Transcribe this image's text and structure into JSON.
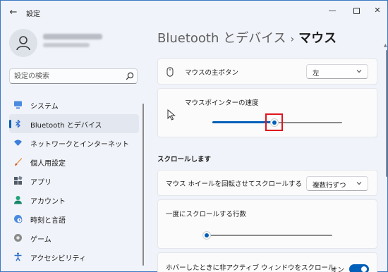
{
  "window": {
    "title": "設定",
    "back_glyph": "←",
    "min_glyph": "—",
    "close_glyph": "✕"
  },
  "sidebar": {
    "search_placeholder": "設定の検索",
    "items": [
      {
        "label": "システム",
        "icon": "monitor-icon",
        "color": "#2f6fce"
      },
      {
        "label": "Bluetooth とデバイス",
        "icon": "bluetooth-icon",
        "color": "#2f6fce",
        "active": true
      },
      {
        "label": "ネットワークとインターネット",
        "icon": "wifi-icon",
        "color": "#3b7fdc"
      },
      {
        "label": "個人用設定",
        "icon": "brush-icon",
        "color": "#e07a3c"
      },
      {
        "label": "アプリ",
        "icon": "apps-icon",
        "color": "#4a5568"
      },
      {
        "label": "アカウント",
        "icon": "account-icon",
        "color": "#1fa27a"
      },
      {
        "label": "時刻と言語",
        "icon": "globe-clock-icon",
        "color": "#2f6fce"
      },
      {
        "label": "ゲーム",
        "icon": "gamepad-icon",
        "color": "#6b6b6b"
      },
      {
        "label": "アクセシビリティ",
        "icon": "accessibility-icon",
        "color": "#2f6fce"
      }
    ]
  },
  "header": {
    "parent": "Bluetooth とデバイス",
    "separator": "›",
    "current": "マウス"
  },
  "main": {
    "primary_button": {
      "label": "マウスの主ボタン",
      "value": "左",
      "icon": "mouse-icon"
    },
    "pointer_speed": {
      "label": "マウスポインターの速度",
      "icon": "pointer-cursor-icon",
      "level_percent": 48
    },
    "section_scroll": "スクロールします",
    "wheel_scroll": {
      "label": "マウス ホイールを回転させてスクロールする",
      "value": "複数行ずつ"
    },
    "lines_per_scroll": {
      "label": "一度にスクロールする行数",
      "level_percent": 2
    },
    "inactive_scroll": {
      "label": "ホバーしたときに非アクティブ ウィンドウをスクロール",
      "state": "オン"
    }
  },
  "colors": {
    "accent": "#005fb8",
    "highlight": "#e0141e"
  }
}
